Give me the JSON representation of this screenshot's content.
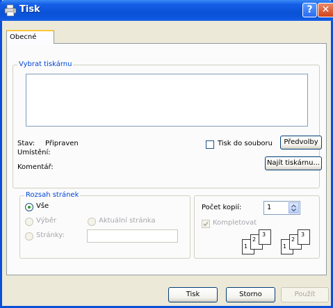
{
  "window": {
    "title": "Tisk"
  },
  "tabs": [
    {
      "label": "Obecné"
    }
  ],
  "printer_group": {
    "legend": "Vybrat tiskárnu",
    "status_label": "Stav:",
    "status_value": "Připraven",
    "location_label": "Umístění:",
    "comment_label": "Komentář:",
    "print_to_file_label": "Tisk do souboru",
    "preferences_button": "Předvolby",
    "find_printer_button": "Najít tiskárnu..."
  },
  "range_group": {
    "legend": "Rozsah stránek",
    "all_label": "Vše",
    "selection_label": "Výběr",
    "current_page_label": "Aktuální stránka",
    "pages_label": "Stránky:",
    "pages_value": ""
  },
  "copies_group": {
    "copies_label": "Počet kopií:",
    "copies_value": "1",
    "collate_label": "Kompletovat",
    "collate_pages_a": [
      "1",
      "2",
      "3"
    ],
    "collate_pages_b": [
      "1",
      "2",
      "3"
    ]
  },
  "footer": {
    "print_button": "Tisk",
    "cancel_button": "Storno",
    "apply_button": "Použít"
  }
}
